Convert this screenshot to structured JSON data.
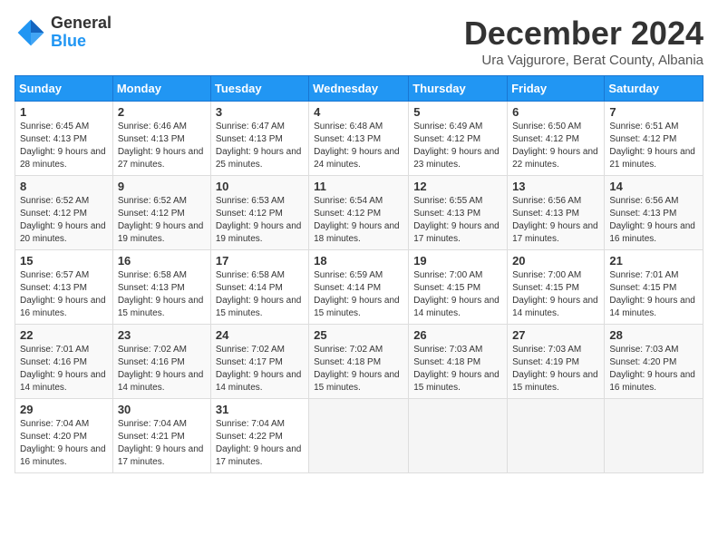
{
  "logo": {
    "general": "General",
    "blue": "Blue"
  },
  "title": "December 2024",
  "location": "Ura Vajgurore, Berat County, Albania",
  "days_header": [
    "Sunday",
    "Monday",
    "Tuesday",
    "Wednesday",
    "Thursday",
    "Friday",
    "Saturday"
  ],
  "weeks": [
    [
      {
        "day": "1",
        "sunrise": "6:45 AM",
        "sunset": "4:13 PM",
        "daylight": "9 hours and 28 minutes."
      },
      {
        "day": "2",
        "sunrise": "6:46 AM",
        "sunset": "4:13 PM",
        "daylight": "9 hours and 27 minutes."
      },
      {
        "day": "3",
        "sunrise": "6:47 AM",
        "sunset": "4:13 PM",
        "daylight": "9 hours and 25 minutes."
      },
      {
        "day": "4",
        "sunrise": "6:48 AM",
        "sunset": "4:13 PM",
        "daylight": "9 hours and 24 minutes."
      },
      {
        "day": "5",
        "sunrise": "6:49 AM",
        "sunset": "4:12 PM",
        "daylight": "9 hours and 23 minutes."
      },
      {
        "day": "6",
        "sunrise": "6:50 AM",
        "sunset": "4:12 PM",
        "daylight": "9 hours and 22 minutes."
      },
      {
        "day": "7",
        "sunrise": "6:51 AM",
        "sunset": "4:12 PM",
        "daylight": "9 hours and 21 minutes."
      }
    ],
    [
      {
        "day": "8",
        "sunrise": "6:52 AM",
        "sunset": "4:12 PM",
        "daylight": "9 hours and 20 minutes."
      },
      {
        "day": "9",
        "sunrise": "6:52 AM",
        "sunset": "4:12 PM",
        "daylight": "9 hours and 19 minutes."
      },
      {
        "day": "10",
        "sunrise": "6:53 AM",
        "sunset": "4:12 PM",
        "daylight": "9 hours and 19 minutes."
      },
      {
        "day": "11",
        "sunrise": "6:54 AM",
        "sunset": "4:12 PM",
        "daylight": "9 hours and 18 minutes."
      },
      {
        "day": "12",
        "sunrise": "6:55 AM",
        "sunset": "4:13 PM",
        "daylight": "9 hours and 17 minutes."
      },
      {
        "day": "13",
        "sunrise": "6:56 AM",
        "sunset": "4:13 PM",
        "daylight": "9 hours and 17 minutes."
      },
      {
        "day": "14",
        "sunrise": "6:56 AM",
        "sunset": "4:13 PM",
        "daylight": "9 hours and 16 minutes."
      }
    ],
    [
      {
        "day": "15",
        "sunrise": "6:57 AM",
        "sunset": "4:13 PM",
        "daylight": "9 hours and 16 minutes."
      },
      {
        "day": "16",
        "sunrise": "6:58 AM",
        "sunset": "4:13 PM",
        "daylight": "9 hours and 15 minutes."
      },
      {
        "day": "17",
        "sunrise": "6:58 AM",
        "sunset": "4:14 PM",
        "daylight": "9 hours and 15 minutes."
      },
      {
        "day": "18",
        "sunrise": "6:59 AM",
        "sunset": "4:14 PM",
        "daylight": "9 hours and 15 minutes."
      },
      {
        "day": "19",
        "sunrise": "7:00 AM",
        "sunset": "4:15 PM",
        "daylight": "9 hours and 14 minutes."
      },
      {
        "day": "20",
        "sunrise": "7:00 AM",
        "sunset": "4:15 PM",
        "daylight": "9 hours and 14 minutes."
      },
      {
        "day": "21",
        "sunrise": "7:01 AM",
        "sunset": "4:15 PM",
        "daylight": "9 hours and 14 minutes."
      }
    ],
    [
      {
        "day": "22",
        "sunrise": "7:01 AM",
        "sunset": "4:16 PM",
        "daylight": "9 hours and 14 minutes."
      },
      {
        "day": "23",
        "sunrise": "7:02 AM",
        "sunset": "4:16 PM",
        "daylight": "9 hours and 14 minutes."
      },
      {
        "day": "24",
        "sunrise": "7:02 AM",
        "sunset": "4:17 PM",
        "daylight": "9 hours and 14 minutes."
      },
      {
        "day": "25",
        "sunrise": "7:02 AM",
        "sunset": "4:18 PM",
        "daylight": "9 hours and 15 minutes."
      },
      {
        "day": "26",
        "sunrise": "7:03 AM",
        "sunset": "4:18 PM",
        "daylight": "9 hours and 15 minutes."
      },
      {
        "day": "27",
        "sunrise": "7:03 AM",
        "sunset": "4:19 PM",
        "daylight": "9 hours and 15 minutes."
      },
      {
        "day": "28",
        "sunrise": "7:03 AM",
        "sunset": "4:20 PM",
        "daylight": "9 hours and 16 minutes."
      }
    ],
    [
      {
        "day": "29",
        "sunrise": "7:04 AM",
        "sunset": "4:20 PM",
        "daylight": "9 hours and 16 minutes."
      },
      {
        "day": "30",
        "sunrise": "7:04 AM",
        "sunset": "4:21 PM",
        "daylight": "9 hours and 17 minutes."
      },
      {
        "day": "31",
        "sunrise": "7:04 AM",
        "sunset": "4:22 PM",
        "daylight": "9 hours and 17 minutes."
      },
      null,
      null,
      null,
      null
    ]
  ],
  "labels": {
    "sunrise": "Sunrise:",
    "sunset": "Sunset:",
    "daylight": "Daylight:"
  }
}
